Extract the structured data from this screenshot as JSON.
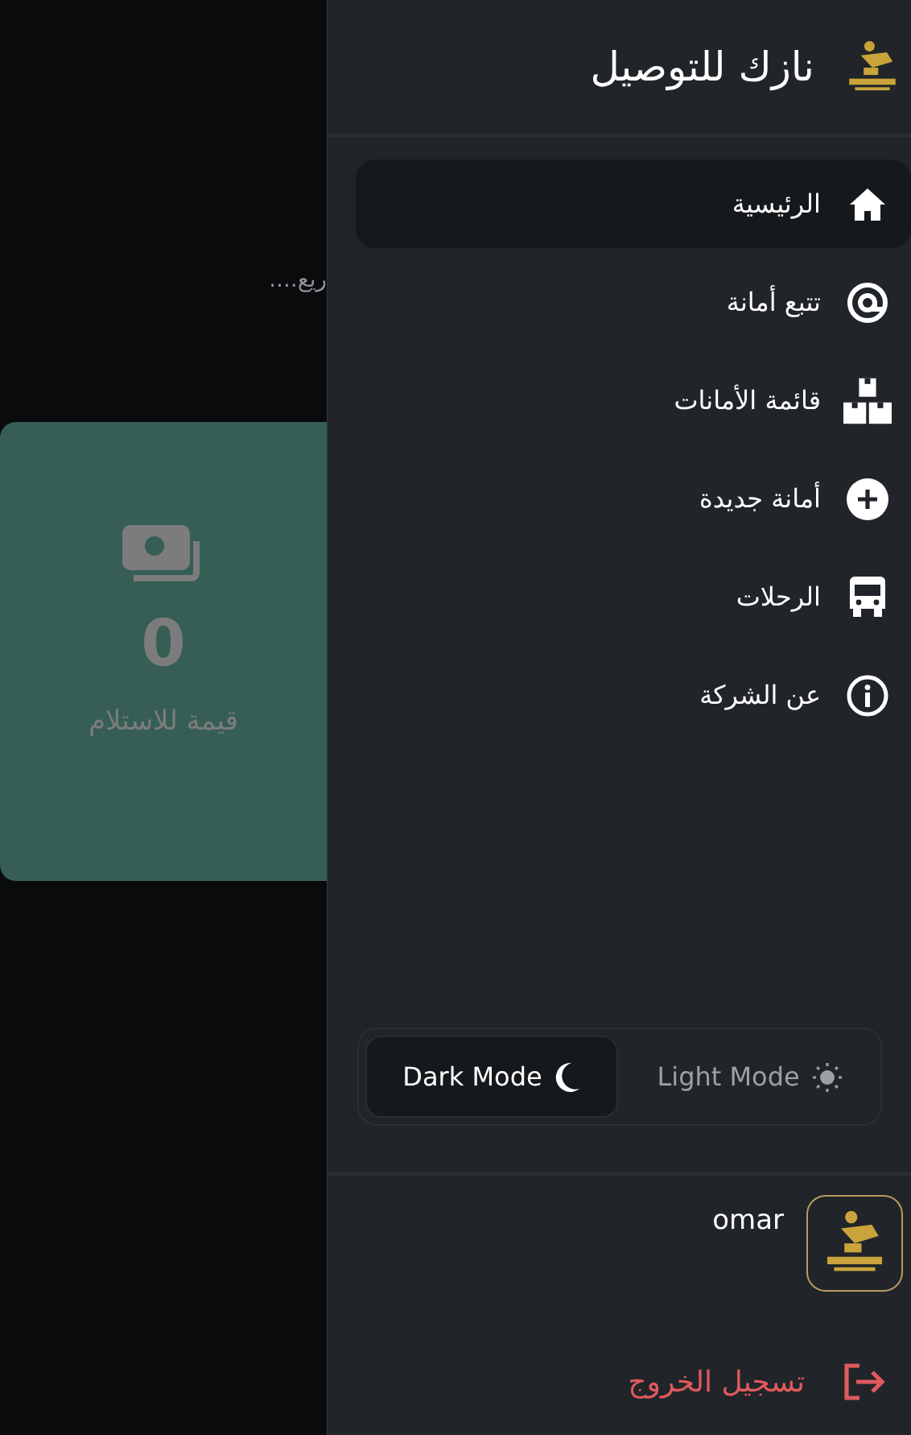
{
  "background": {
    "caption": "ريع....",
    "card": {
      "value": "0",
      "label": "قيمة للاستلام"
    }
  },
  "drawer": {
    "title": "نازك للتوصيل",
    "menu": [
      {
        "label": "الرئيسية",
        "selected": true
      },
      {
        "label": "تتبع أمانة",
        "selected": false
      },
      {
        "label": "قائمة الأمانات",
        "selected": false
      },
      {
        "label": "أمانة جديدة",
        "selected": false
      },
      {
        "label": "الرحلات",
        "selected": false
      },
      {
        "label": "عن الشركة",
        "selected": false
      }
    ],
    "theme_toggle": [
      {
        "label": "Light Mode",
        "selected": false
      },
      {
        "label": "Dark Mode",
        "selected": true
      }
    ],
    "user": {
      "name": "omar"
    },
    "logout": "تسجيل الخروج"
  }
}
